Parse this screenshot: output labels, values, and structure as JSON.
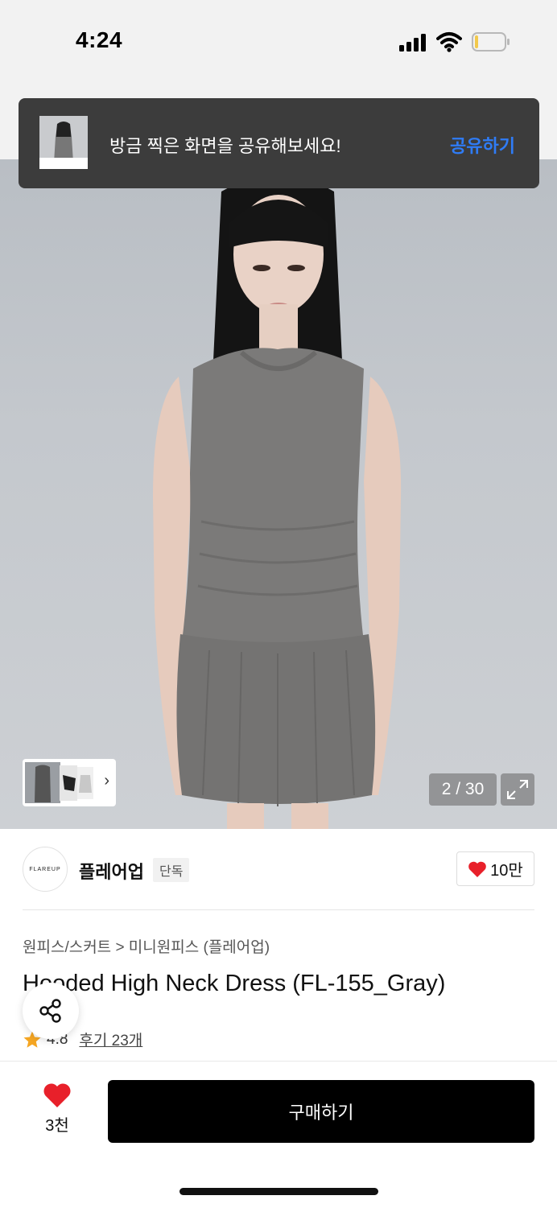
{
  "status": {
    "time": "4:24"
  },
  "toast": {
    "message": "방금 찍은 화면을 공유해보세요!",
    "action": "공유하기"
  },
  "gallery": {
    "counter": "2 / 30"
  },
  "brand": {
    "name": "플레어업",
    "badge": "단독",
    "logo_text": "FLAREUP",
    "likes": "10만"
  },
  "product": {
    "breadcrumb": "원피스/스커트 > 미니원피스 (플레어업)",
    "title": "Hooded High Neck Dress (FL-155_Gray)",
    "rating": "4.8",
    "reviews": "후기 23개"
  },
  "bottom": {
    "wish_count": "3천",
    "buy_label": "구매하기"
  },
  "colors": {
    "accent": "#2f7cf6",
    "heart": "#e8202a",
    "star": "#f5a623"
  }
}
